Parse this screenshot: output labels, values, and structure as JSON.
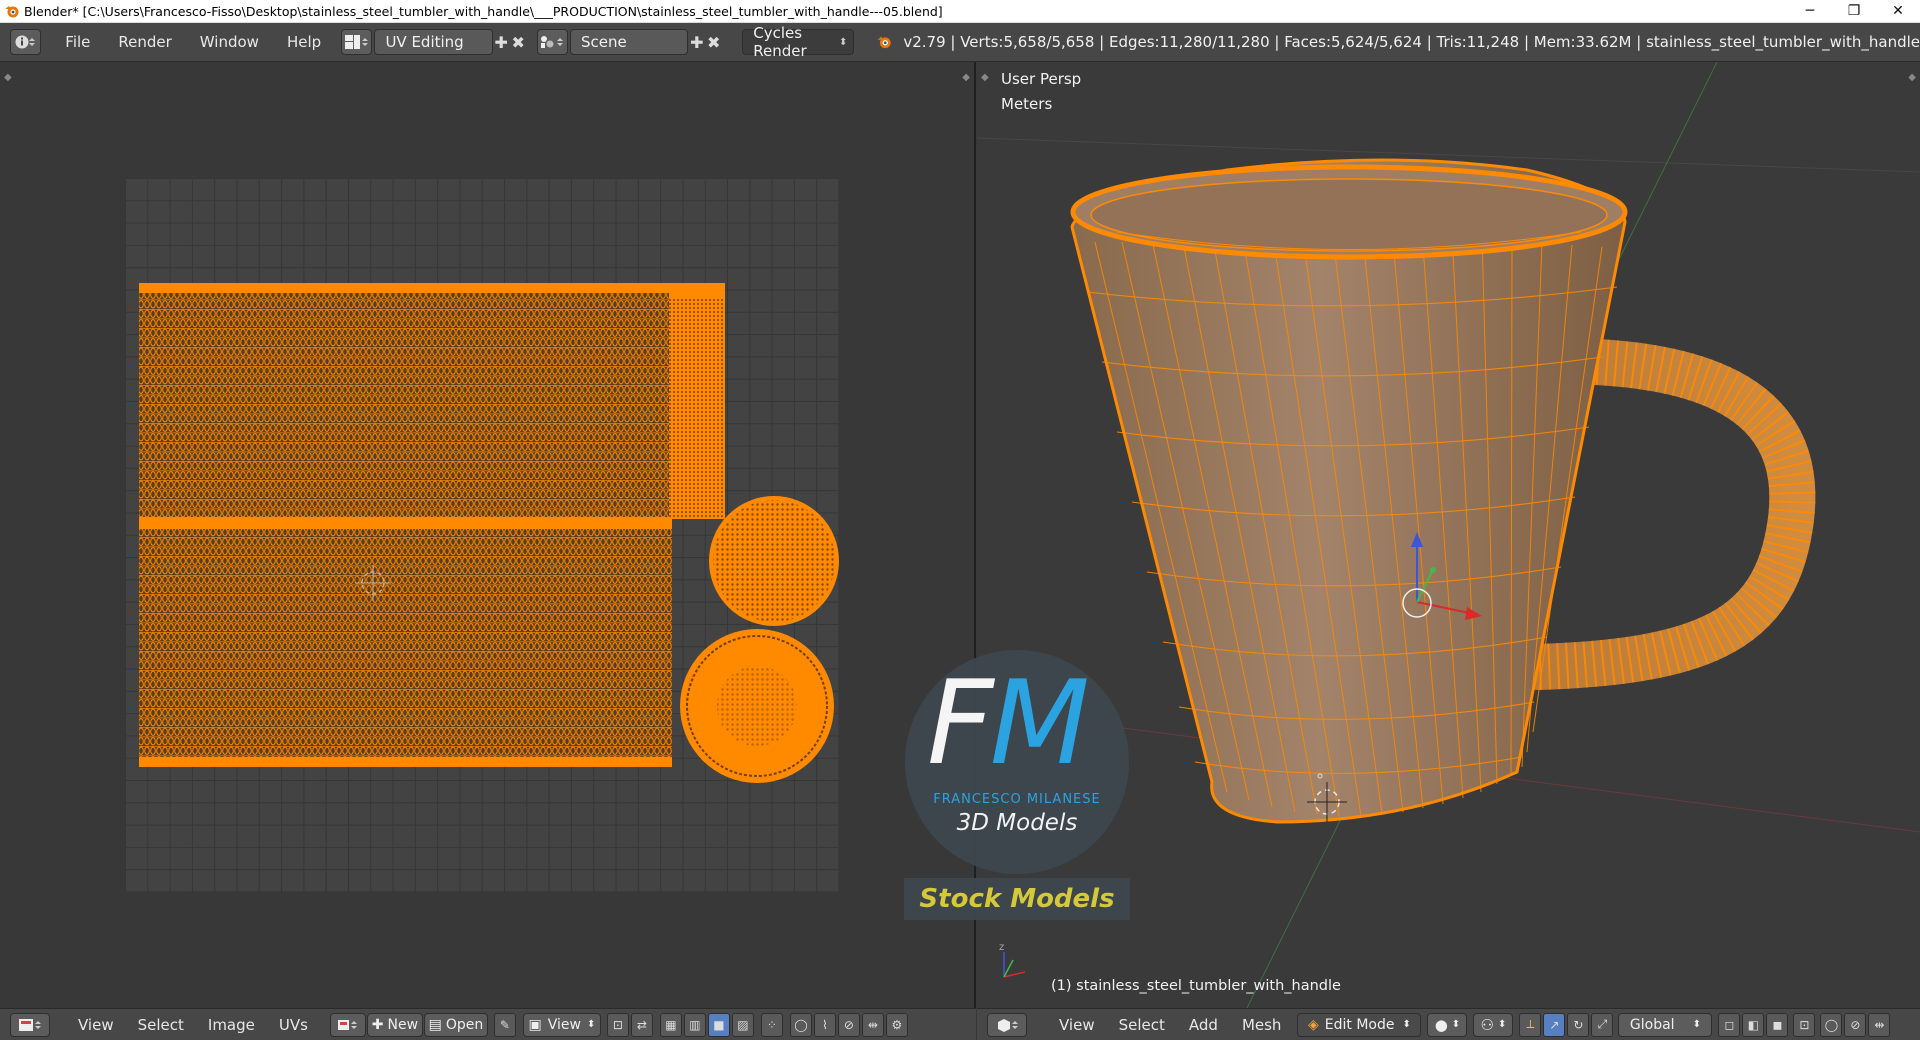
{
  "window": {
    "title": "Blender* [C:\\Users\\Francesco-Fisso\\Desktop\\stainless_steel_tumbler_with_handle\\___PRODUCTION\\stainless_steel_tumbler_with_handle---05.blend]",
    "minimize": "─",
    "maximize": "❐",
    "close": "✕"
  },
  "infobar": {
    "menus": [
      "File",
      "Render",
      "Window",
      "Help"
    ],
    "screen_layout": "UV Editing",
    "scene": "Scene",
    "render_engine": "Cycles Render",
    "stats": "v2.79 | Verts:5,658/5,658 | Edges:11,280/11,280 | Faces:5,624/5,624 | Tris:11,248 | Mem:33.62M | stainless_steel_tumbler_with_handle"
  },
  "uv_editor": {
    "footer_menus": [
      "View",
      "Select",
      "Image",
      "UVs"
    ],
    "new_label": "New",
    "open_label": "Open",
    "view_label": "View"
  },
  "viewport": {
    "view_name": "User Persp",
    "units": "Meters",
    "object_label": "(1) stainless_steel_tumbler_with_handle",
    "footer_menus": [
      "View",
      "Select",
      "Add",
      "Mesh"
    ],
    "mode": "Edit Mode",
    "orientation": "Global"
  },
  "watermark": {
    "logo_letters": "FM",
    "brand": "FRANCESCO MILANESE",
    "subtitle": "3D Models",
    "tagline": "Stock Models"
  },
  "colors": {
    "selection_orange": "#ff8a00",
    "header_bg": "#474747",
    "accent_blue": "#5680c2"
  }
}
